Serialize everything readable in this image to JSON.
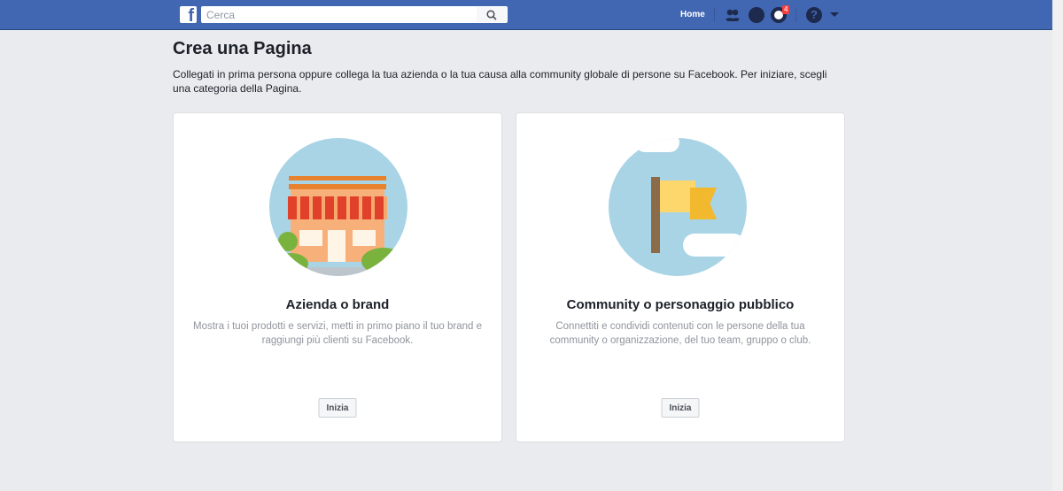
{
  "header": {
    "search_placeholder": "Cerca",
    "home": "Home",
    "notifications_count": "4"
  },
  "page": {
    "title": "Crea una Pagina",
    "intro": "Collegati in prima persona oppure collega la tua azienda o la tua causa alla community globale di persone su Facebook. Per iniziare, scegli una categoria della Pagina."
  },
  "cards": [
    {
      "title": "Azienda o brand",
      "description": "Mostra i tuoi prodotti e servizi, metti in primo piano il tuo brand e raggiungi più clienti su Facebook.",
      "button": "Inizia"
    },
    {
      "title": "Community o personaggio pubblico",
      "description": "Connettiti e condividi contenuti con le persone della tua community o organizzazione, del tuo team, gruppo o club.",
      "button": "Inizia"
    }
  ]
}
